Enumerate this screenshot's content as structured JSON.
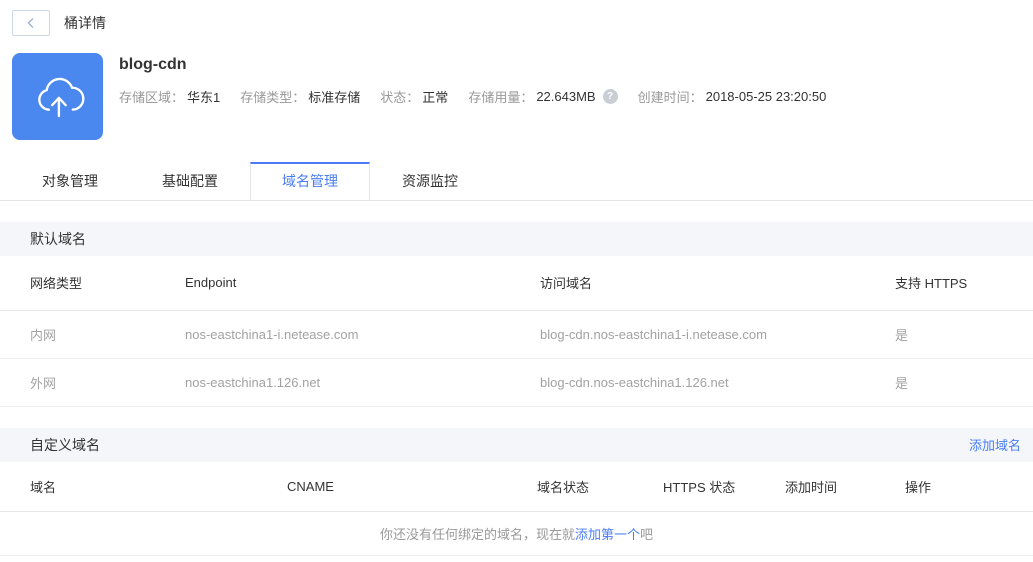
{
  "colors": {
    "accent": "#4a7df5",
    "icon_blue": "#4a87ee"
  },
  "topbar": {
    "title": "桶详情"
  },
  "bucket": {
    "name": "blog-cdn",
    "info": [
      {
        "label": "存储区域：",
        "value": "华东1"
      },
      {
        "label": "存储类型：",
        "value": "标准存储"
      },
      {
        "label": "状态：",
        "value": "正常"
      },
      {
        "label": "存储用量：",
        "value": "22.643MB"
      },
      {
        "label": "创建时间：",
        "value": "2018-05-25 23:20:50"
      }
    ],
    "help_icon": "?"
  },
  "tabs": [
    {
      "label": "对象管理"
    },
    {
      "label": "基础配置"
    },
    {
      "label": "域名管理"
    },
    {
      "label": "资源监控"
    }
  ],
  "default_domains": {
    "section_title": "默认域名",
    "columns": [
      "网络类型",
      "Endpoint",
      "访问域名",
      "支持 HTTPS"
    ],
    "rows": [
      [
        "内网",
        "nos-eastchina1-i.netease.com",
        "blog-cdn.nos-eastchina1-i.netease.com",
        "是"
      ],
      [
        "外网",
        "nos-eastchina1.126.net",
        "blog-cdn.nos-eastchina1.126.net",
        "是"
      ]
    ]
  },
  "custom_domains": {
    "section_title": "自定义域名",
    "add_link": "添加域名",
    "columns": [
      "域名",
      "CNAME",
      "域名状态",
      "HTTPS 状态",
      "添加时间",
      "操作"
    ],
    "empty": {
      "prefix": "你还没有任何绑定的域名，现在就",
      "link": "添加第一个",
      "suffix": "吧"
    }
  }
}
